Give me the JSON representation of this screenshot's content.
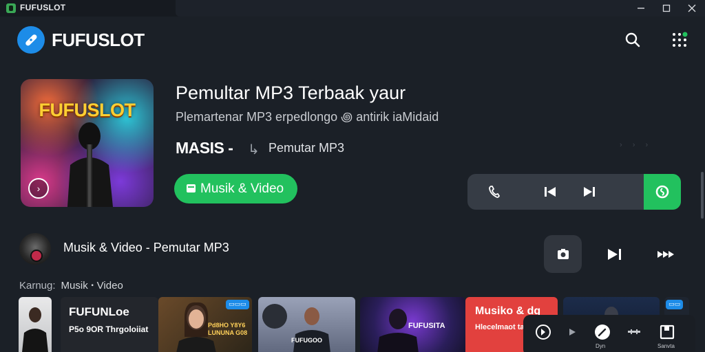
{
  "window": {
    "title": "FUFUSLOT",
    "minimize_icon": "minimize-icon",
    "maximize_icon": "maximize-icon",
    "close_icon": "close-icon"
  },
  "header": {
    "brand": "FUFUSLOT",
    "search_icon": "search-icon",
    "menu_icon": "apps-grid-icon"
  },
  "hero": {
    "album_art_text": "FUFUSLOT",
    "title": "Pemultar MP3 Terbaak yaur",
    "subtitle": "Plemartenar MP3 erpedlongo ꩜ antirik iaMidaid",
    "artist": "MASIS -",
    "album": "Pemutar MP3",
    "primary_button": "Musik & Video",
    "faint_arrows": "› › ›"
  },
  "player": {
    "accent": "#22c15e",
    "buttons": [
      "phone-icon",
      "previous-icon",
      "next-icon",
      "shazam-icon"
    ]
  },
  "now_playing": {
    "label": "Musik & Video - Pemutar MP3",
    "buttons": [
      "camera-icon",
      "skip-next-icon",
      "fast-forward-icon"
    ]
  },
  "section": {
    "label": "Karnug:",
    "value": "Musik ꞏ Video"
  },
  "cards": [
    {
      "kind": "person"
    },
    {
      "title": "FUFUNLoe",
      "subtitle": "P5o 9OR Thrgoloiiat"
    },
    {
      "badge": "▭▭▭",
      "caption": "Pd8HO Y8Y6\nLUNUNA G08"
    },
    {
      "caption": "FUFUGOO"
    },
    {
      "caption": "FUFUSITA"
    },
    {
      "title": "Musiko & dg",
      "subtitle": "Hlecelmaot tao"
    },
    {
      "kind": "concert"
    },
    {
      "badge": "▭▭"
    }
  ],
  "mini_player": {
    "labels": [
      "Dyn",
      "Sanvta"
    ],
    "icons": [
      "compass-icon",
      "play-icon",
      "pen-icon",
      "equalizer-icon",
      "save-icon"
    ]
  },
  "colors": {
    "background": "#1b2027",
    "accent_green": "#22c15e",
    "accent_blue": "#1d8ce8"
  }
}
